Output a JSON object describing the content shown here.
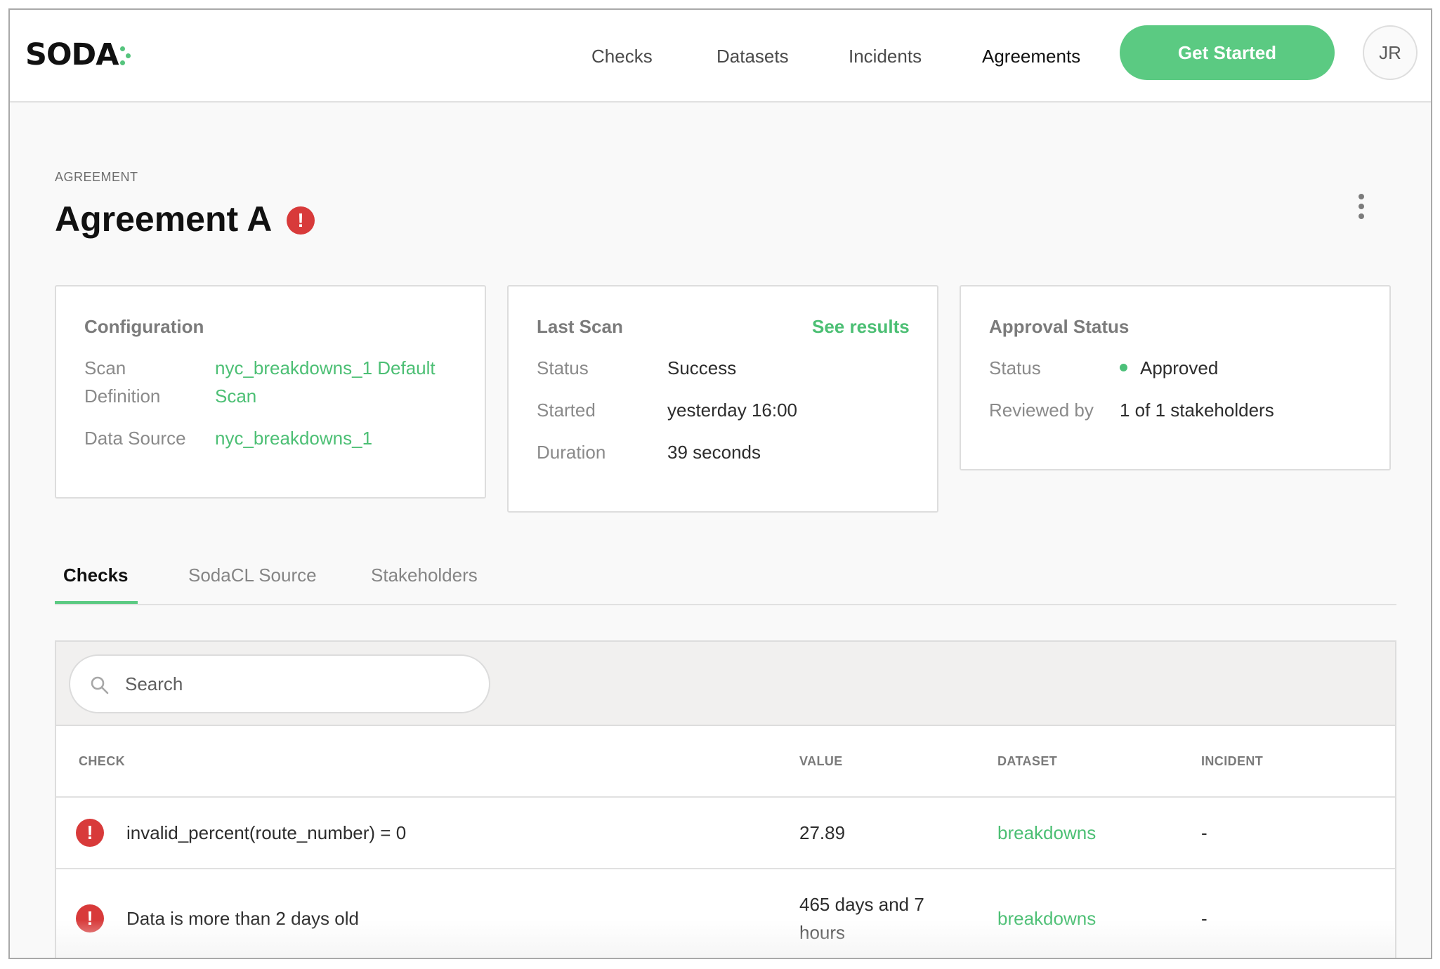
{
  "brand": {
    "logo_text": "SODA",
    "accent": "#5bca82",
    "error": "#d83a3a",
    "link": "#4cbf74"
  },
  "nav": {
    "items": [
      {
        "label": "Checks"
      },
      {
        "label": "Datasets"
      },
      {
        "label": "Incidents"
      },
      {
        "label": "Agreements"
      }
    ],
    "active": "Agreements",
    "cta_label": "Get Started",
    "avatar_initials": "JR"
  },
  "page": {
    "overline": "AGREEMENT",
    "title": "Agreement A",
    "status_icon": "error-icon",
    "more_icon": "more-vertical-icon"
  },
  "cards": {
    "configuration": {
      "title": "Configuration",
      "scan_definition_label_1": "Scan",
      "scan_definition_label_2": "Definition",
      "scan_definition_value_1": "nyc_breakdowns_1 Default",
      "scan_definition_value_2": "Scan",
      "data_source_label": "Data Source",
      "data_source_value": "nyc_breakdowns_1"
    },
    "last_scan": {
      "title": "Last Scan",
      "link": "See results",
      "status_label": "Status",
      "status_value": "Success",
      "started_label": "Started",
      "started_value": "yesterday 16:00",
      "duration_label": "Duration",
      "duration_value": "39 seconds"
    },
    "approval": {
      "title": "Approval Status",
      "status_label": "Status",
      "status_value": "Approved",
      "reviewed_label": "Reviewed by",
      "reviewed_value": "1 of 1 stakeholders"
    }
  },
  "tabs": [
    {
      "label": "Checks",
      "active": true
    },
    {
      "label": "SodaCL Source",
      "active": false
    },
    {
      "label": "Stakeholders",
      "active": false
    }
  ],
  "search": {
    "placeholder": "Search",
    "value": ""
  },
  "table": {
    "columns": [
      "CHECK",
      "VALUE",
      "DATASET",
      "INCIDENT"
    ],
    "rows": [
      {
        "status_icon": "error-icon",
        "check": "invalid_percent(route_number) = 0",
        "value_1": "27.89",
        "value_2": "",
        "dataset": "breakdowns",
        "incident": "-"
      },
      {
        "status_icon": "error-icon",
        "check": "Data is more than 2 days old",
        "value_1": "465 days and 7",
        "value_2": "hours",
        "dataset": "breakdowns",
        "incident": "-"
      }
    ]
  }
}
